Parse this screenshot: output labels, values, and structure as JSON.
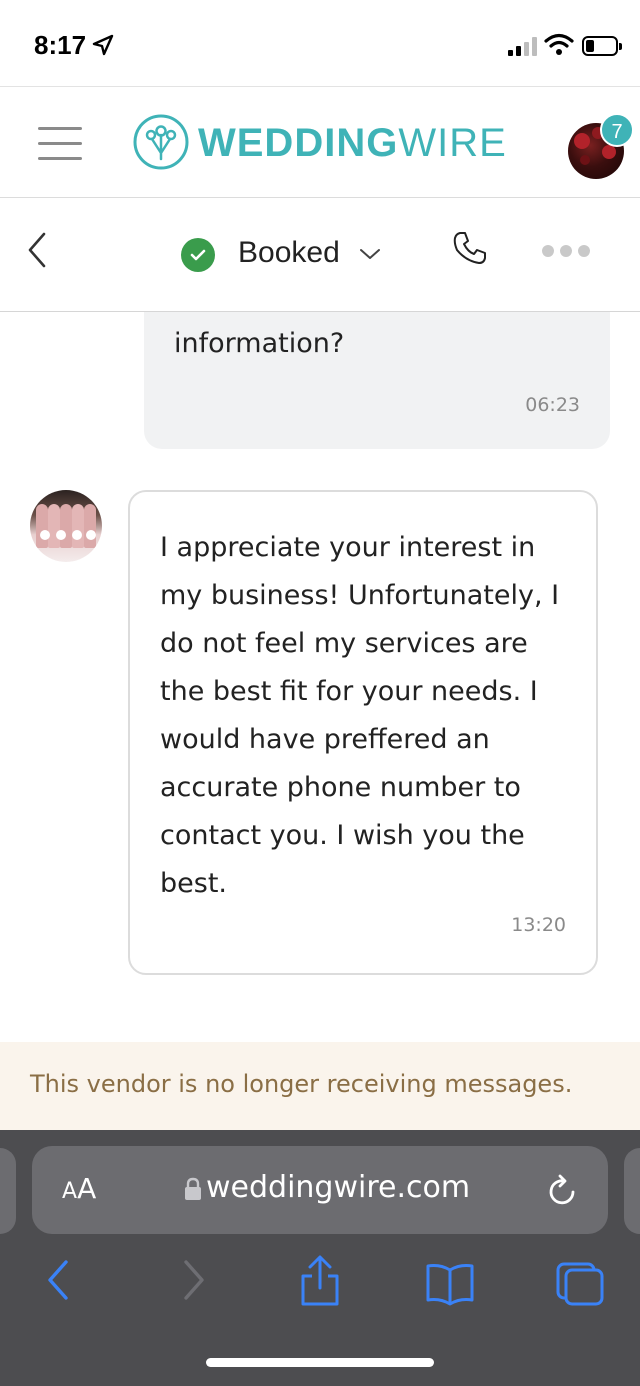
{
  "status_bar": {
    "time": "8:17",
    "icons": [
      "location-arrow-icon",
      "cellular-signal-icon",
      "wifi-icon",
      "battery-icon"
    ]
  },
  "header": {
    "logo_text_bold": "WEDDING",
    "logo_text_light": "WIRE",
    "notification_count": "7",
    "brand_color": "#3fb3b7"
  },
  "conversation_bar": {
    "status_label": "Booked",
    "status_color": "#3a9c4c",
    "icons": [
      "back-chevron-icon",
      "check-icon",
      "chevron-down-icon",
      "phone-icon",
      "more-icon"
    ]
  },
  "messages": [
    {
      "direction": "outgoing",
      "text": "send some additional information?",
      "time": "06:23"
    },
    {
      "direction": "incoming",
      "text": "I appreciate your interest in my business! Unfortunately, I do not feel my services are the best fit for your needs. I would have preffered an accurate phone number to contact you. I wish you the best.",
      "time": "13:20"
    }
  ],
  "notice": {
    "text": "This vendor is no longer receiving messages.",
    "color": "#8a6e45"
  },
  "browser": {
    "text_size_label": "AA",
    "url": "weddingwire.com",
    "toolbar_icons": [
      "back-icon",
      "forward-icon",
      "share-icon",
      "bookmarks-icon",
      "tabs-icon"
    ],
    "accent": "#3a82f7"
  }
}
